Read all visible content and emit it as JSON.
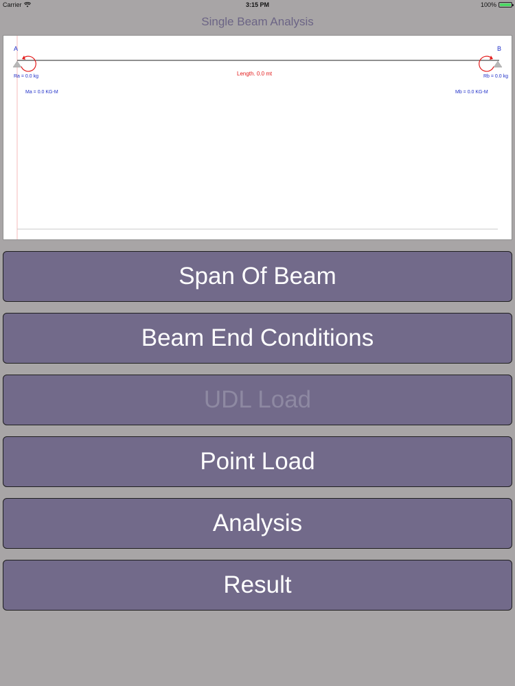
{
  "status_bar": {
    "carrier": "Carrier",
    "time": "3:15 PM",
    "battery_percent": "100%",
    "battery_level": 1.0
  },
  "nav": {
    "title": "Single Beam Analysis"
  },
  "diagram": {
    "point_a": "A",
    "point_b": "B",
    "reaction_a": "Ra = 0.0 kg",
    "reaction_b": "Rb = 0.0 kg",
    "length": "Length. 0.0 mt",
    "moment_a": "Ma = 0.0 KG-M",
    "moment_b": "Mb = 0.0 KG-M"
  },
  "buttons": [
    {
      "label": "Span Of Beam",
      "enabled": true
    },
    {
      "label": "Beam End Conditions",
      "enabled": true
    },
    {
      "label": "UDL Load",
      "enabled": false
    },
    {
      "label": "Point Load",
      "enabled": true
    },
    {
      "label": "Analysis",
      "enabled": true
    },
    {
      "label": "Result",
      "enabled": true
    }
  ],
  "colors": {
    "background": "#a8a5a6",
    "button": "#726a8a",
    "title": "#6b6485",
    "diagram_text": "#1f2fc8",
    "diagram_accent": "#e31b1b"
  }
}
